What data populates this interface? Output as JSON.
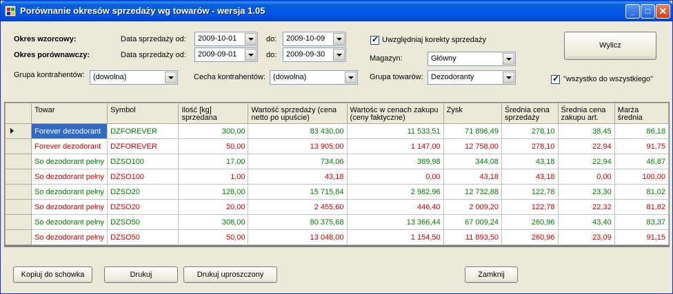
{
  "window": {
    "title": "Porównanie okresów sprzedaży wg towarów - wersja 1.05",
    "controls": {
      "minimize": "_",
      "maximize": "□",
      "close": "✕"
    }
  },
  "form": {
    "okres_wzorcowy": "Okres wzorcowy:",
    "okres_porownawczy": "Okres porównawczy:",
    "data_od_label": "Data sprzedaży od:",
    "do_label": "do:",
    "wz_od": "2009-10-01",
    "wz_do": "2009-10-09",
    "por_od": "2009-09-01",
    "por_do": "2009-09-30",
    "korekty_label": "Uwzględniaj korekty sprzedaży",
    "magazyn_label": "Magazyn:",
    "magazyn_value": "Główny",
    "grupa_kontr_label": "Grupa kontrahentów:",
    "grupa_kontr_value": "(dowolna)",
    "cecha_kontr_label": "Cecha kontrahentów:",
    "cecha_kontr_value": "(dowolna)",
    "grupa_tow_label": "Grupa towarów:",
    "grupa_tow_value": "Dezodoranty",
    "wylicz_label": "Wylicz",
    "wszystko_label": "\"wszystko do wszystkiego\""
  },
  "grid": {
    "columns": [
      "Towar",
      "Symbol",
      "Ilość [kg] sprzedana",
      "Wartość sprzedaży (cena netto po upuście)",
      "Wartośc w cenach zakupu (ceny faktyczne)",
      "Zysk",
      "Średnia cena sprzedaży",
      "Średnia cena zakupu art.",
      "Marża średnia"
    ],
    "rows": [
      {
        "color": "g",
        "cells": [
          "Forever dezodorant",
          "DZFOREVER",
          "300,00",
          "83 430,00",
          "11 533,51",
          "71 896,49",
          "278,10",
          "38,45",
          "86,18"
        ]
      },
      {
        "color": "r",
        "cells": [
          "Forever dezodorant",
          "DZFOREVER",
          "50,00",
          "13 905,00",
          "1 147,00",
          "12 758,00",
          "278,10",
          "22,94",
          "91,75"
        ]
      },
      {
        "color": "g",
        "cells": [
          "So dezodorant pełny",
          "DZSO100",
          "17,00",
          "734,06",
          "389,98",
          "344,08",
          "43,18",
          "22,94",
          "46,87"
        ]
      },
      {
        "color": "r",
        "cells": [
          "So dezodorant pełny",
          "DZSO100",
          "1,00",
          "43,18",
          "0,00",
          "43,18",
          "43,18",
          "0,00",
          "100,00"
        ]
      },
      {
        "color": "g",
        "cells": [
          "So dezodorant pełny",
          "DZSO20",
          "128,00",
          "15 715,84",
          "2 982,96",
          "12 732,88",
          "122,78",
          "23,30",
          "81,02"
        ]
      },
      {
        "color": "r",
        "cells": [
          "So dezodorant pełny",
          "DZSO20",
          "20,00",
          "2 455,60",
          "446,40",
          "2 009,20",
          "122,78",
          "22,32",
          "81,82"
        ]
      },
      {
        "color": "g",
        "cells": [
          "So dezodorant pełny",
          "DZSO50",
          "308,00",
          "80 375,68",
          "13 366,44",
          "67 009,24",
          "260,96",
          "43,40",
          "83,37"
        ]
      },
      {
        "color": "r",
        "cells": [
          "So dezodorant pełny",
          "DZSO50",
          "50,00",
          "13 048,00",
          "1 154,50",
          "11 893,50",
          "260,96",
          "23,09",
          "91,15"
        ]
      }
    ]
  },
  "buttons": {
    "kopiuj": "Kopiuj do schowka",
    "drukuj": "Drukuj",
    "drukuj_upr": "Drukuj uproszczony",
    "zamknij": "Zamknij"
  }
}
